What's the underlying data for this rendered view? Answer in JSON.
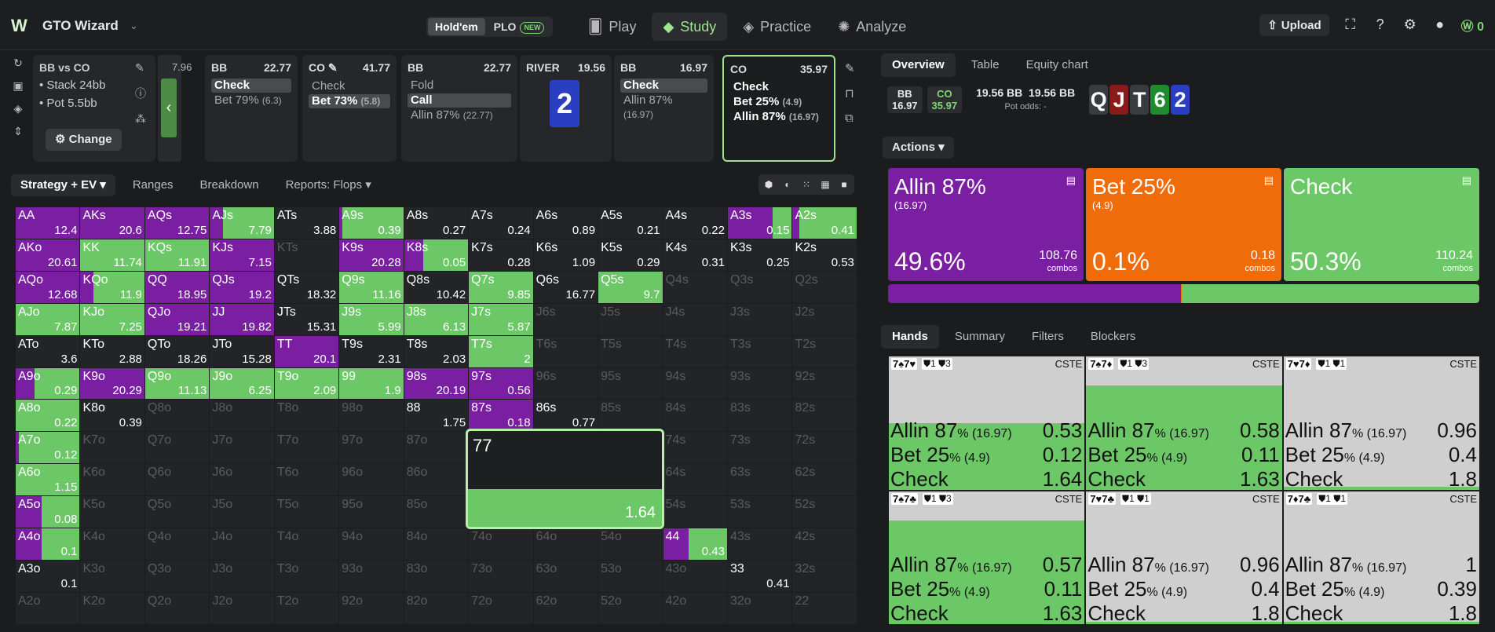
{
  "app": {
    "title": "GTO Wizard"
  },
  "variant": {
    "holdem": "Hold'em",
    "plo": "PLO",
    "plo_badge": "NEW"
  },
  "nav": [
    {
      "label": "Play",
      "icon": "cards-icon"
    },
    {
      "label": "Study",
      "icon": "grad-cap-icon"
    },
    {
      "label": "Practice",
      "icon": "gamepad-icon"
    },
    {
      "label": "Analyze",
      "icon": "bulb-icon"
    }
  ],
  "topright": {
    "upload": "Upload",
    "credits": "0"
  },
  "info": {
    "title": "BB vs CO",
    "stack": "• Stack 24bb",
    "pot": "• Pot 5.5bb",
    "change": "Change"
  },
  "back_value": "7.96",
  "action_cards": [
    {
      "player": "BB",
      "stack": "22.77",
      "rows": [
        {
          "t": "Check",
          "sel": true
        },
        {
          "t": "Bet 79%",
          "s": "(6.3)"
        }
      ]
    },
    {
      "player": "CO ✎",
      "stack": "41.77",
      "rows": [
        {
          "t": "Check"
        },
        {
          "t": "Bet 73%",
          "s": "(5.8)",
          "sel": true
        }
      ]
    },
    {
      "player": "BB",
      "stack": "22.77",
      "rows": [
        {
          "t": "Fold"
        },
        {
          "t": "Call",
          "sel": true
        },
        {
          "t": "Allin 87%",
          "s": "(22.77)"
        }
      ]
    },
    {
      "player": "BB",
      "stack": "16.97",
      "rows": [
        {
          "t": "Check",
          "sel": true
        },
        {
          "t": "Allin 87%",
          "s": "(16.97)"
        }
      ]
    },
    {
      "player": "CO",
      "stack": "35.97",
      "rows": [
        {
          "t": "Check"
        },
        {
          "t": "Bet 25%",
          "s": "(4.9)"
        },
        {
          "t": "Allin 87%",
          "s": "(16.97)"
        }
      ]
    }
  ],
  "river": {
    "label": "RIVER",
    "value": "19.56",
    "card": "2"
  },
  "view_tabs": [
    "Strategy + EV ▾",
    "Ranges",
    "Breakdown",
    "Reports: Flops ▾"
  ],
  "grid": [
    [
      [
        "AA",
        "12.4",
        100,
        0
      ],
      [
        "AKs",
        "20.6",
        100,
        0
      ],
      [
        "AQs",
        "12.75",
        100,
        0
      ],
      [
        "AJs",
        "7.79",
        20,
        80
      ],
      [
        "ATs",
        "3.88",
        0,
        0
      ],
      [
        "A9s",
        "0.39",
        5,
        95
      ],
      [
        "A8s",
        "0.27",
        0,
        0
      ],
      [
        "A7s",
        "0.24",
        0,
        0
      ],
      [
        "A6s",
        "0.89",
        0,
        0
      ],
      [
        "A5s",
        "0.21",
        0,
        0
      ],
      [
        "A4s",
        "0.22",
        0,
        0
      ],
      [
        "A3s",
        "0.15",
        70,
        30
      ],
      [
        "A2s",
        "0.41",
        10,
        90
      ]
    ],
    [
      [
        "AKo",
        "20.61",
        100,
        0
      ],
      [
        "KK",
        "11.74",
        0,
        100
      ],
      [
        "KQs",
        "11.91",
        0,
        100
      ],
      [
        "KJs",
        "7.15",
        100,
        0
      ],
      [
        "KTs",
        "",
        0,
        0
      ],
      [
        "K9s",
        "20.28",
        100,
        0
      ],
      [
        "K8s",
        "0.05",
        30,
        70
      ],
      [
        "K7s",
        "0.28",
        0,
        0
      ],
      [
        "K6s",
        "1.09",
        0,
        0
      ],
      [
        "K5s",
        "0.29",
        0,
        0
      ],
      [
        "K4s",
        "0.31",
        0,
        0
      ],
      [
        "K3s",
        "0.25",
        0,
        0
      ],
      [
        "K2s",
        "0.53",
        0,
        0
      ]
    ],
    [
      [
        "AQo",
        "12.68",
        100,
        0
      ],
      [
        "KQo",
        "11.9",
        20,
        80
      ],
      [
        "QQ",
        "18.95",
        100,
        0
      ],
      [
        "QJs",
        "19.2",
        100,
        0
      ],
      [
        "QTs",
        "18.32",
        0,
        0
      ],
      [
        "Q9s",
        "11.16",
        0,
        100
      ],
      [
        "Q8s",
        "10.42",
        0,
        0
      ],
      [
        "Q7s",
        "9.85",
        0,
        100
      ],
      [
        "Q6s",
        "16.77",
        0,
        0
      ],
      [
        "Q5s",
        "9.7",
        0,
        100
      ],
      [
        "Q4s",
        "",
        0,
        0
      ],
      [
        "Q3s",
        "",
        0,
        0
      ],
      [
        "Q2s",
        "",
        0,
        0
      ]
    ],
    [
      [
        "AJo",
        "7.87",
        0,
        100
      ],
      [
        "KJo",
        "7.25",
        0,
        100
      ],
      [
        "QJo",
        "19.21",
        100,
        0
      ],
      [
        "JJ",
        "19.82",
        100,
        0
      ],
      [
        "JTs",
        "15.31",
        0,
        0
      ],
      [
        "J9s",
        "5.99",
        0,
        100
      ],
      [
        "J8s",
        "6.13",
        0,
        100
      ],
      [
        "J7s",
        "5.87",
        0,
        100
      ],
      [
        "J6s",
        "",
        0,
        0
      ],
      [
        "J5s",
        "",
        0,
        0
      ],
      [
        "J4s",
        "",
        0,
        0
      ],
      [
        "J3s",
        "",
        0,
        0
      ],
      [
        "J2s",
        "",
        0,
        0
      ]
    ],
    [
      [
        "ATo",
        "3.6",
        0,
        0
      ],
      [
        "KTo",
        "2.88",
        0,
        0
      ],
      [
        "QTo",
        "18.26",
        0,
        0
      ],
      [
        "JTo",
        "15.28",
        0,
        0
      ],
      [
        "TT",
        "20.1",
        100,
        0
      ],
      [
        "T9s",
        "2.31",
        0,
        0
      ],
      [
        "T8s",
        "2.03",
        0,
        0
      ],
      [
        "T7s",
        "2",
        0,
        100
      ],
      [
        "T6s",
        "",
        0,
        0
      ],
      [
        "T5s",
        "",
        0,
        0
      ],
      [
        "T4s",
        "",
        0,
        0
      ],
      [
        "T3s",
        "",
        0,
        0
      ],
      [
        "T2s",
        "",
        0,
        0
      ]
    ],
    [
      [
        "A9o",
        "0.29",
        30,
        70
      ],
      [
        "K9o",
        "20.29",
        100,
        0
      ],
      [
        "Q9o",
        "11.13",
        0,
        100
      ],
      [
        "J9o",
        "6.25",
        0,
        100
      ],
      [
        "T9o",
        "2.09",
        0,
        100
      ],
      [
        "99",
        "1.9",
        0,
        100
      ],
      [
        "98s",
        "20.19",
        100,
        0
      ],
      [
        "97s",
        "0.56",
        100,
        0
      ],
      [
        "96s",
        "",
        0,
        0
      ],
      [
        "95s",
        "",
        0,
        0
      ],
      [
        "94s",
        "",
        0,
        0
      ],
      [
        "93s",
        "",
        0,
        0
      ],
      [
        "92s",
        "",
        0,
        0
      ]
    ],
    [
      [
        "A8o",
        "0.22",
        0,
        100
      ],
      [
        "K8o",
        "0.39",
        0,
        0
      ],
      [
        "Q8o",
        "",
        0,
        0
      ],
      [
        "J8o",
        "",
        0,
        0
      ],
      [
        "T8o",
        "",
        0,
        0
      ],
      [
        "98o",
        "",
        0,
        0
      ],
      [
        "88",
        "1.75",
        0,
        0
      ],
      [
        "87s",
        "0.18",
        100,
        0
      ],
      [
        "86s",
        "0.77",
        0,
        0
      ],
      [
        "85s",
        "",
        0,
        0
      ],
      [
        "84s",
        "",
        0,
        0
      ],
      [
        "83s",
        "",
        0,
        0
      ],
      [
        "82s",
        "",
        0,
        0
      ]
    ],
    [
      [
        "A7o",
        "0.12",
        5,
        95
      ],
      [
        "K7o",
        "",
        0,
        0
      ],
      [
        "Q7o",
        "",
        0,
        0
      ],
      [
        "J7o",
        "",
        0,
        0
      ],
      [
        "T7o",
        "",
        0,
        0
      ],
      [
        "97o",
        "",
        0,
        0
      ],
      [
        "87o",
        "",
        0,
        0
      ],
      [
        "77",
        "",
        0,
        0
      ],
      [
        "76s",
        "",
        0,
        0
      ],
      [
        "75s",
        "",
        0,
        0
      ],
      [
        "74s",
        "",
        0,
        0
      ],
      [
        "73s",
        "",
        0,
        0
      ],
      [
        "72s",
        "",
        0,
        0
      ]
    ],
    [
      [
        "A6o",
        "1.15",
        0,
        100
      ],
      [
        "K6o",
        "",
        0,
        0
      ],
      [
        "Q6o",
        "",
        0,
        0
      ],
      [
        "J6o",
        "",
        0,
        0
      ],
      [
        "T6o",
        "",
        0,
        0
      ],
      [
        "96o",
        "",
        0,
        0
      ],
      [
        "86o",
        "",
        0,
        0
      ],
      [
        "76o",
        "",
        0,
        0
      ],
      [
        "66",
        "",
        0,
        0
      ],
      [
        "65s",
        "",
        0,
        0
      ],
      [
        "64s",
        "",
        0,
        0
      ],
      [
        "63s",
        "",
        0,
        0
      ],
      [
        "62s",
        "",
        0,
        0
      ]
    ],
    [
      [
        "A5o",
        "0.08",
        40,
        60
      ],
      [
        "K5o",
        "",
        0,
        0
      ],
      [
        "Q5o",
        "",
        0,
        0
      ],
      [
        "J5o",
        "",
        0,
        0
      ],
      [
        "T5o",
        "",
        0,
        0
      ],
      [
        "95o",
        "",
        0,
        0
      ],
      [
        "85o",
        "",
        0,
        0
      ],
      [
        "75o",
        "",
        0,
        0
      ],
      [
        "65o",
        "",
        0,
        0
      ],
      [
        "55",
        "",
        0,
        0
      ],
      [
        "54s",
        "",
        0,
        0
      ],
      [
        "53s",
        "",
        0,
        0
      ],
      [
        "52s",
        "",
        0,
        0
      ]
    ],
    [
      [
        "A4o",
        "0.1",
        40,
        60
      ],
      [
        "K4o",
        "",
        0,
        0
      ],
      [
        "Q4o",
        "",
        0,
        0
      ],
      [
        "J4o",
        "",
        0,
        0
      ],
      [
        "T4o",
        "",
        0,
        0
      ],
      [
        "94o",
        "",
        0,
        0
      ],
      [
        "84o",
        "",
        0,
        0
      ],
      [
        "74o",
        "",
        0,
        0
      ],
      [
        "64o",
        "",
        0,
        0
      ],
      [
        "54o",
        "",
        0,
        0
      ],
      [
        "44",
        "0.43",
        40,
        60
      ],
      [
        "43s",
        "",
        0,
        0
      ],
      [
        "42s",
        "",
        0,
        0
      ]
    ],
    [
      [
        "A3o",
        "0.1",
        0,
        0
      ],
      [
        "K3o",
        "",
        0,
        0
      ],
      [
        "Q3o",
        "",
        0,
        0
      ],
      [
        "J3o",
        "",
        0,
        0
      ],
      [
        "T3o",
        "",
        0,
        0
      ],
      [
        "93o",
        "",
        0,
        0
      ],
      [
        "83o",
        "",
        0,
        0
      ],
      [
        "73o",
        "",
        0,
        0
      ],
      [
        "63o",
        "",
        0,
        0
      ],
      [
        "53o",
        "",
        0,
        0
      ],
      [
        "43o",
        "",
        0,
        0
      ],
      [
        "33",
        "0.41",
        0,
        0
      ],
      [
        "32s",
        "",
        0,
        0
      ]
    ],
    [
      [
        "A2o",
        "",
        0,
        0
      ],
      [
        "K2o",
        "",
        0,
        0
      ],
      [
        "Q2o",
        "",
        0,
        0
      ],
      [
        "J2o",
        "",
        0,
        0
      ],
      [
        "T2o",
        "",
        0,
        0
      ],
      [
        "92o",
        "",
        0,
        0
      ],
      [
        "82o",
        "",
        0,
        0
      ],
      [
        "72o",
        "",
        0,
        0
      ],
      [
        "62o",
        "",
        0,
        0
      ],
      [
        "52o",
        "",
        0,
        0
      ],
      [
        "42o",
        "",
        0,
        0
      ],
      [
        "32o",
        "",
        0,
        0
      ],
      [
        "22",
        "",
        0,
        0
      ]
    ]
  ],
  "zoom": {
    "hand": "77",
    "ev": "1.64",
    "check_frac": 0.38
  },
  "right_tabs": [
    "Overview",
    "Table",
    "Equity chart"
  ],
  "stacks": {
    "bb_label": "BB",
    "bb": "16.97",
    "co_label": "CO",
    "co": "35.97",
    "pot": "19.56 BB",
    "pot2": "19.56 BB",
    "pot_odds": "Pot odds:  -"
  },
  "board": [
    {
      "r": "Q",
      "c": "#3a3b3f"
    },
    {
      "r": "J",
      "c": "#8b1a1a"
    },
    {
      "r": "T",
      "c": "#3a3b3f"
    },
    {
      "r": "6",
      "c": "#1f8a2e"
    },
    {
      "r": "2",
      "c": "#2a3ec2"
    }
  ],
  "actions_label": "Actions",
  "actions": [
    {
      "name": "Allin 87%",
      "size": "(16.97)",
      "pct": "49.6%",
      "combos": "108.76",
      "combos_lbl": "combos",
      "color": "#7a1fa2",
      "frac": 0.496
    },
    {
      "name": "Bet 25%",
      "size": "(4.9)",
      "pct": "0.1%",
      "combos": "0.18",
      "combos_lbl": "combos",
      "color": "#f06b0a",
      "frac": 0.001
    },
    {
      "name": "Check",
      "size": "",
      "pct": "50.3%",
      "combos": "110.24",
      "combos_lbl": "combos",
      "color": "#6cc866",
      "frac": 0.503
    }
  ],
  "hand_tabs": [
    "Hands",
    "Summary",
    "Filters",
    "Blockers"
  ],
  "combos": [
    {
      "cards": "7♠7♥",
      "bl": [
        "1",
        "3"
      ],
      "tag": "CSTE",
      "allin": "0.53",
      "bet": "0.12",
      "check": "1.64",
      "fill": 0.5
    },
    {
      "cards": "7♠7♦",
      "bl": [
        "1",
        "3"
      ],
      "tag": "CSTE",
      "allin": "0.58",
      "bet": "0.11",
      "check": "1.63",
      "fill": 0.78
    },
    {
      "cards": "7♥7♦",
      "bl": [
        "1",
        "1"
      ],
      "tag": "CSTE",
      "allin": "0.96",
      "bet": "0.4",
      "check": "1.8",
      "fill": 0.02
    },
    {
      "cards": "7♠7♣",
      "bl": [
        "1",
        "3"
      ],
      "tag": "CSTE",
      "allin": "0.57",
      "bet": "0.11",
      "check": "1.63",
      "fill": 0.78
    },
    {
      "cards": "7♥7♣",
      "bl": [
        "1",
        "1"
      ],
      "tag": "CSTE",
      "allin": "0.96",
      "bet": "0.4",
      "check": "1.8",
      "fill": 0.02
    },
    {
      "cards": "7♦7♣",
      "bl": [
        "1",
        "1"
      ],
      "tag": "CSTE",
      "allin": "1",
      "bet": "0.39",
      "check": "1.8",
      "fill": 0.02
    }
  ],
  "combo_labels": {
    "allin": "Allin 87",
    "allin_s": "% (16.97)",
    "bet": "Bet 25",
    "bet_s": "% (4.9)",
    "check": "Check"
  }
}
